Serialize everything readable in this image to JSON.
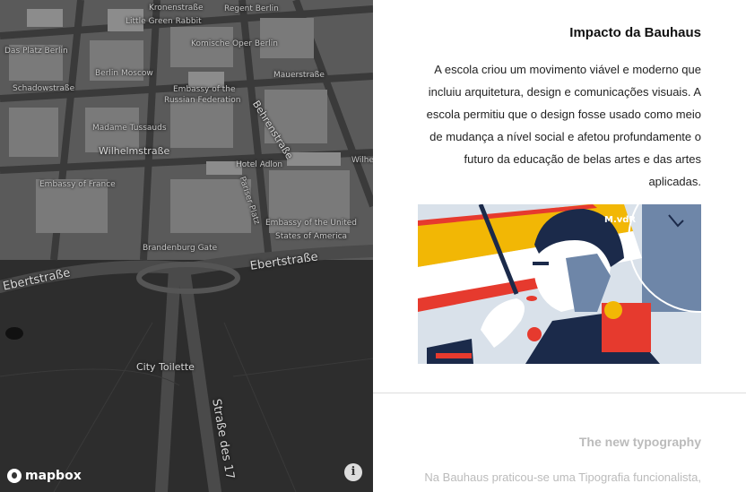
{
  "map": {
    "labels": {
      "kronenstrasse": "Kronenstraße",
      "little_green_rabbit": "Little Green Rabbit",
      "regent_berlin": "Regent Berlin",
      "das_platz_berlin": "Das Platz Berlin",
      "komische_oper": "Komische Oper Berlin",
      "mauerstrasse": "Mauerstraße",
      "berlin_moscow": "Berlin Moscow",
      "schadowstrasse": "Schadowstraße",
      "embassy_russian_1": "Embassy of the",
      "embassy_russian_2": "Russian Federation",
      "behrenstrasse": "Behrenstraße",
      "madame_tussauds": "Madame Tussauds",
      "wilhelmstrasse": "Wilhelmstraße",
      "hotel_adlon": "Hotel Adlon",
      "wilh": "Wilhe",
      "embassy_france": "Embassy of France",
      "pariser_platz": "Pariser Platz",
      "embassy_usa_1": "Embassy of the United",
      "embassy_usa_2": "States of America",
      "brandenburg_gate": "Brandenburg Gate",
      "ebertstrasse_right": "Ebertstraße",
      "ebertstrasse_left": "Ebertstraße",
      "city_toilette": "City Toilette",
      "strasse_des_17": "Straße des 17"
    },
    "attribution": "mapbox",
    "info_glyph": "i"
  },
  "story": {
    "section1": {
      "title": "Impacto da Bauhaus",
      "body": "A escola criou um movimento viável e moderno que incluiu arquitetura, design e comunicações visuais. A escola permitiu que o design fosse usado como meio de mudança a nível social e afetou profundamente o futuro da educação de belas artes e das artes aplicadas.",
      "illustration_caption": "M.vdR"
    },
    "section2": {
      "title": "The new typography",
      "body": "Na Bauhaus praticou-se uma Tipografia funcionalista,"
    }
  },
  "colors": {
    "map_bg": "#2b2b2b",
    "illus_yellow": "#f2b705",
    "illus_red": "#e63a2e",
    "illus_navy": "#1b2a4a",
    "illus_slate": "#6e86a8"
  }
}
